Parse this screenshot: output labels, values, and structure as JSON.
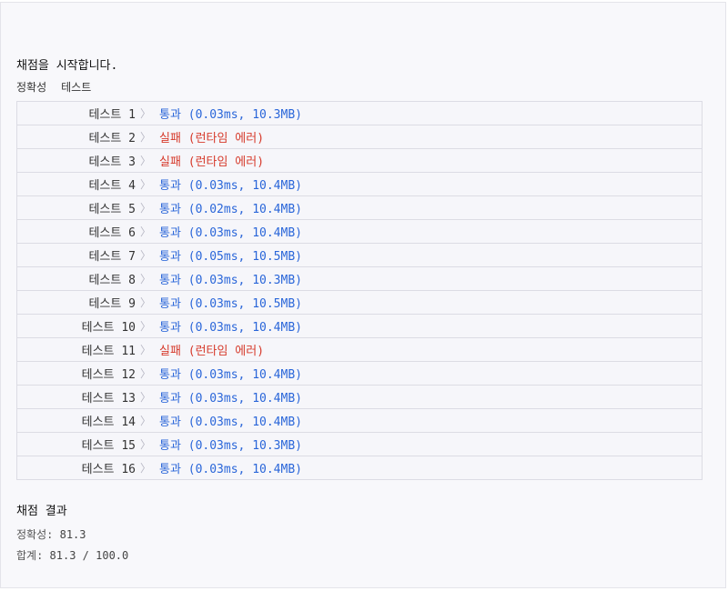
{
  "header": {
    "title": "채점을 시작합니다.",
    "section_label_1": "정확성",
    "section_label_2": "테스트"
  },
  "results": [
    {
      "label": "테스트 1",
      "status": "통과",
      "detail": "(0.03ms, 10.3MB)",
      "passed": true
    },
    {
      "label": "테스트 2",
      "status": "실패",
      "detail": "(런타임 에러)",
      "passed": false
    },
    {
      "label": "테스트 3",
      "status": "실패",
      "detail": "(런타임 에러)",
      "passed": false
    },
    {
      "label": "테스트 4",
      "status": "통과",
      "detail": "(0.03ms, 10.4MB)",
      "passed": true
    },
    {
      "label": "테스트 5",
      "status": "통과",
      "detail": "(0.02ms, 10.4MB)",
      "passed": true
    },
    {
      "label": "테스트 6",
      "status": "통과",
      "detail": "(0.03ms, 10.4MB)",
      "passed": true
    },
    {
      "label": "테스트 7",
      "status": "통과",
      "detail": "(0.05ms, 10.5MB)",
      "passed": true
    },
    {
      "label": "테스트 8",
      "status": "통과",
      "detail": "(0.03ms, 10.3MB)",
      "passed": true
    },
    {
      "label": "테스트 9",
      "status": "통과",
      "detail": "(0.03ms, 10.5MB)",
      "passed": true
    },
    {
      "label": "테스트 10",
      "status": "통과",
      "detail": "(0.03ms, 10.4MB)",
      "passed": true
    },
    {
      "label": "테스트 11",
      "status": "실패",
      "detail": "(런타임 에러)",
      "passed": false
    },
    {
      "label": "테스트 12",
      "status": "통과",
      "detail": "(0.03ms, 10.4MB)",
      "passed": true
    },
    {
      "label": "테스트 13",
      "status": "통과",
      "detail": "(0.03ms, 10.4MB)",
      "passed": true
    },
    {
      "label": "테스트 14",
      "status": "통과",
      "detail": "(0.03ms, 10.4MB)",
      "passed": true
    },
    {
      "label": "테스트 15",
      "status": "통과",
      "detail": "(0.03ms, 10.3MB)",
      "passed": true
    },
    {
      "label": "테스트 16",
      "status": "통과",
      "detail": "(0.03ms, 10.4MB)",
      "passed": true
    }
  ],
  "summary": {
    "title": "채점 결과",
    "accuracy_label": "정확성:",
    "accuracy_value": "81.3",
    "total_label": "합계:",
    "total_value": "81.3 / 100.0"
  },
  "colors": {
    "pass": "#2a66d9",
    "fail": "#d63a2b"
  },
  "icons": {
    "row_chevron": "chevron-right-icon"
  }
}
